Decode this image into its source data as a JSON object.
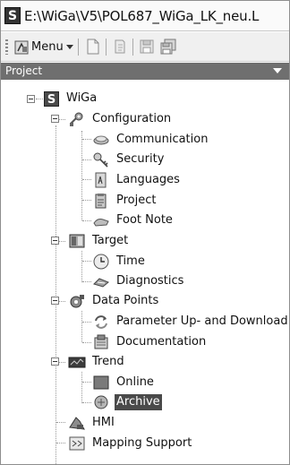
{
  "window": {
    "title": "E:\\WiGa\\V5\\POL687_WiGa_LK_neu.L"
  },
  "toolbar": {
    "menu_label": "Menu"
  },
  "panel": {
    "title": "Project"
  },
  "tree": {
    "root": "WiGa",
    "configuration": {
      "label": "Configuration",
      "children": [
        "Communication",
        "Security",
        "Languages",
        "Project",
        "Foot Note"
      ]
    },
    "target": {
      "label": "Target",
      "children": [
        "Time",
        "Diagnostics"
      ]
    },
    "data_points": {
      "label": "Data Points",
      "children": [
        "Parameter Up- and Download",
        "Documentation"
      ]
    },
    "trend": {
      "label": "Trend",
      "children": [
        "Online",
        "Archive"
      ],
      "selected": "Archive"
    },
    "hmi": {
      "label": "HMI"
    },
    "mapping": {
      "label": "Mapping Support"
    }
  }
}
